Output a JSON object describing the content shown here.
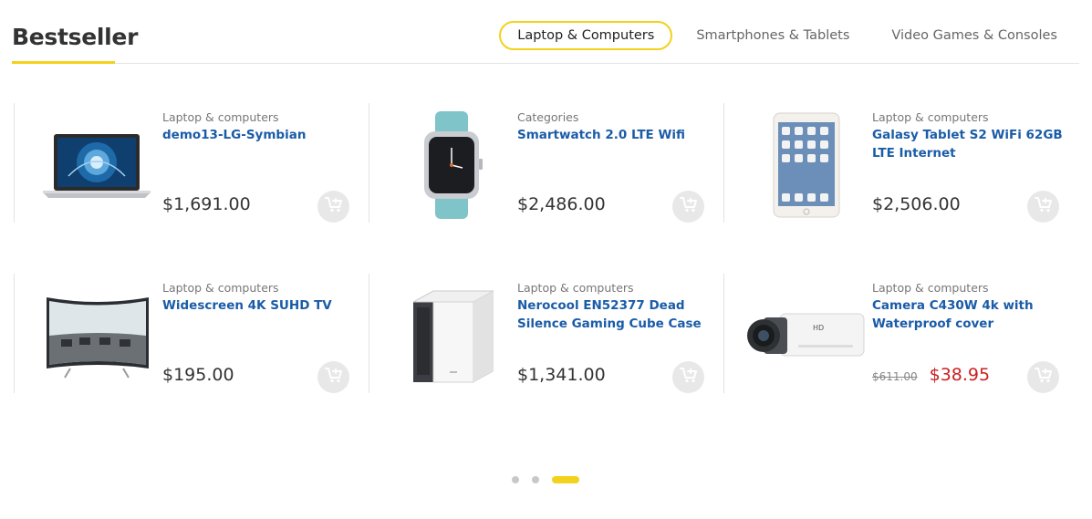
{
  "section": {
    "title": "Bestseller"
  },
  "tabs": [
    {
      "label": "Laptop & Computers",
      "active": true
    },
    {
      "label": "Smartphones & Tablets",
      "active": false
    },
    {
      "label": "Video Games & Consoles",
      "active": false
    }
  ],
  "products": [
    {
      "category": "Laptop & computers",
      "name": "demo13-LG-Symbian",
      "price": "$1,691.00",
      "image_icon": "laptop-image"
    },
    {
      "category": "Categories",
      "name": "Smartwatch 2.0 LTE Wifi",
      "price": "$2,486.00",
      "image_icon": "smartwatch-image"
    },
    {
      "category": "Laptop & computers",
      "name": "Galasy Tablet S2 WiFi 62GB LTE Internet",
      "price": "$2,506.00",
      "image_icon": "tablet-image"
    },
    {
      "category": "Laptop & computers",
      "name": "Widescreen 4K SUHD TV",
      "price": "$195.00",
      "image_icon": "tv-image"
    },
    {
      "category": "Laptop & computers",
      "name": "Nerocool EN52377 Dead Silence Gaming Cube Case",
      "price": "$1,341.00",
      "image_icon": "pc-case-image"
    },
    {
      "category": "Laptop & computers",
      "name": "Camera C430W 4k with Waterproof cover",
      "old_price": "$611.00",
      "sale_price": "$38.95",
      "image_icon": "camcorder-image"
    }
  ],
  "pagination": {
    "pages": 3,
    "active_index": 2
  },
  "colors": {
    "accent": "#f2d21c",
    "link": "#1a5ca8",
    "sale": "#cc1f1f"
  }
}
